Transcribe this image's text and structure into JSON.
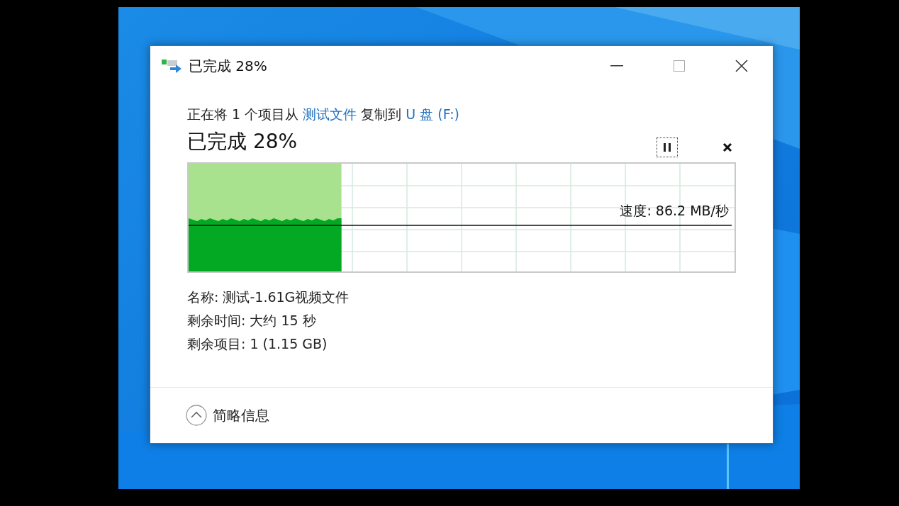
{
  "window": {
    "title": "已完成 28%"
  },
  "copy_line": [
    {
      "kind": "text",
      "text": "正在将 1 个项目从 "
    },
    {
      "kind": "link",
      "text": "测试文件"
    },
    {
      "kind": "text",
      "text": " 复制到 "
    },
    {
      "kind": "link",
      "text": "U 盘 (F:)"
    }
  ],
  "progress_heading": "已完成 28%",
  "progress": {
    "level": 0.28,
    "speed": "速度: 86.2 MB/秒"
  },
  "details": [
    "名称: 测试-1.61G视频文件",
    "剩余时间: 大约 15 秒",
    "剩余项目: 1 (1.15 GB)"
  ],
  "footer": {
    "toggle_label": "简略信息",
    "expanded": true
  }
}
